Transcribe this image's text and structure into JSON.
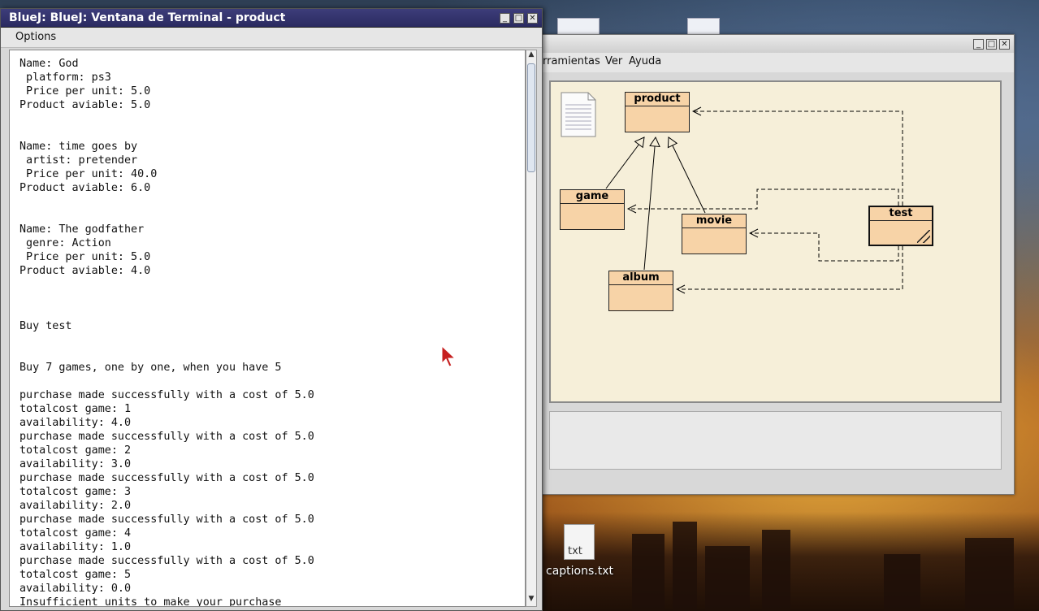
{
  "desktop": {
    "file_icon_ext": "txt",
    "file_icon_label": "captions.txt"
  },
  "class_window": {
    "menu": [
      "rramientas",
      "Ver",
      "Ayuda"
    ],
    "classes": {
      "product": "product",
      "game": "game",
      "movie": "movie",
      "album": "album",
      "test": "test"
    }
  },
  "terminal": {
    "title": "BlueJ: BlueJ:  Ventana de Terminal - product",
    "menu_options": "Options",
    "lines": [
      "Name: God",
      " platform: ps3",
      " Price per unit: 5.0",
      "Product aviable: 5.0",
      "",
      "",
      "Name: time goes by",
      " artist: pretender",
      " Price per unit: 40.0",
      "Product aviable: 6.0",
      "",
      "",
      "Name: The godfather",
      " genre: Action",
      " Price per unit: 5.0",
      "Product aviable: 4.0",
      "",
      "",
      "",
      "Buy test",
      "",
      "",
      "Buy 7 games, one by one, when you have 5",
      "",
      "purchase made successfully with a cost of 5.0",
      "totalcost game: 1",
      "availability: 4.0",
      "purchase made successfully with a cost of 5.0",
      "totalcost game: 2",
      "availability: 3.0",
      "purchase made successfully with a cost of 5.0",
      "totalcost game: 3",
      "availability: 2.0",
      "purchase made successfully with a cost of 5.0",
      "totalcost game: 4",
      "availability: 1.0",
      "purchase made successfully with a cost of 5.0",
      "totalcost game: 5",
      "availability: 0.0",
      "Insufficient units to make your purchase"
    ]
  },
  "icons": {
    "minimize": "minimize-icon",
    "maximize": "maximize-icon",
    "close": "close-icon"
  }
}
